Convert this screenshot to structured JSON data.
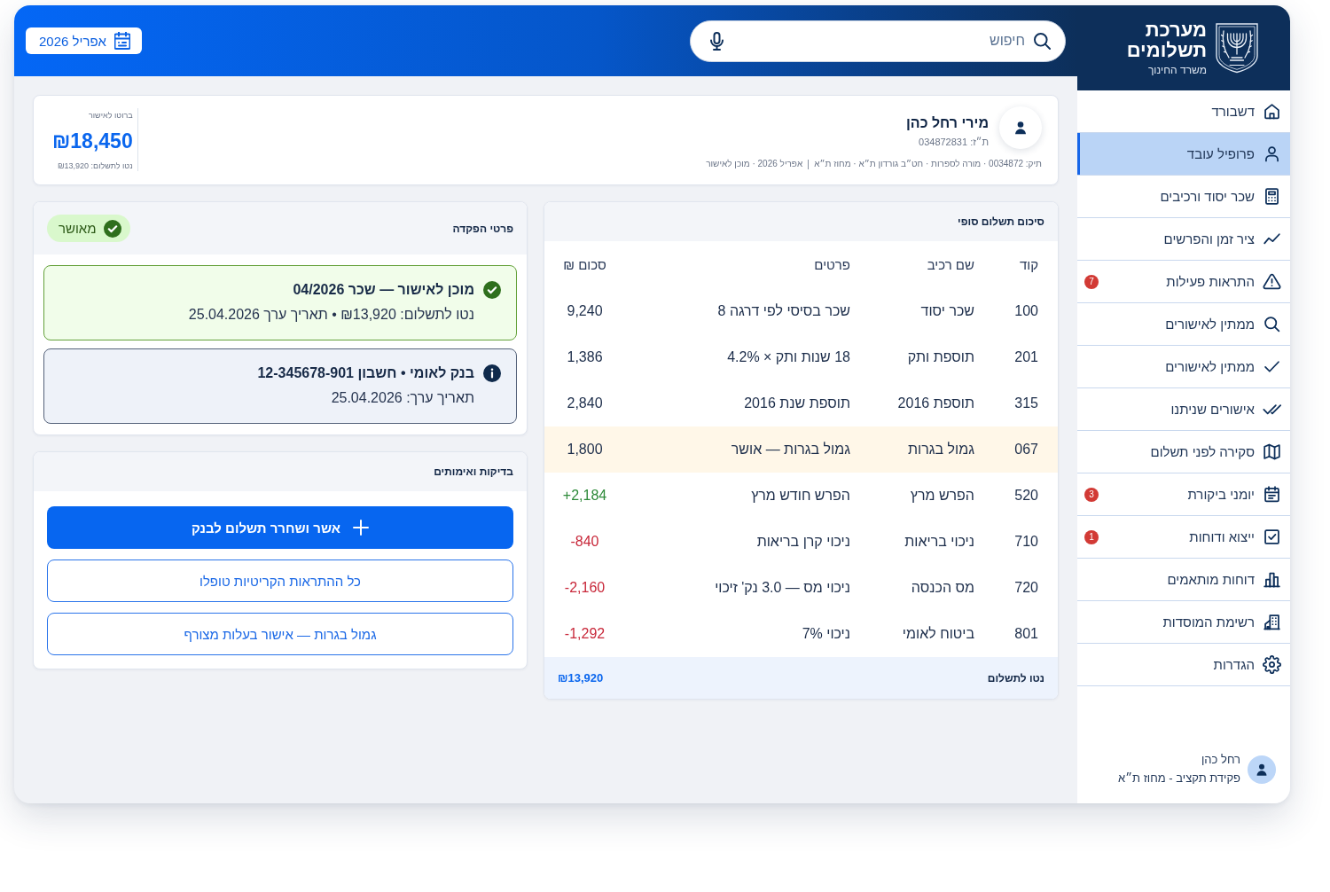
{
  "sidebar": {
    "logo": {
      "title": "מערכת תשלומים",
      "subtitle": "משרד החינוך"
    },
    "items": [
      {
        "label": "דשבורד",
        "selected": false
      },
      {
        "label": "פרופיל עובד",
        "selected": true
      },
      {
        "label": "שכר יסוד ורכיבים",
        "selected": false
      },
      {
        "label": "ציר זמן והפרשים",
        "selected": false
      },
      {
        "label": "התראות פעילות",
        "selected": false,
        "badge": "7"
      },
      {
        "label": "ממתין לאישורים",
        "selected": false
      },
      {
        "label": "ממתין לאישורים",
        "selected": false
      },
      {
        "label": "אישורים שניתנו",
        "selected": false
      },
      {
        "label": "סקירה לפני תשלום",
        "selected": false
      },
      {
        "label": "יומני ביקורת",
        "selected": false,
        "badge": "3"
      },
      {
        "label": "ייצוא ודוחות",
        "selected": false,
        "badge": "1"
      },
      {
        "label": "דוחות מותאמים",
        "selected": false
      },
      {
        "label": "רשימת המוסדות",
        "selected": false
      },
      {
        "label": "הגדרות",
        "selected": false
      }
    ],
    "user": {
      "name": "רחל כהן",
      "role": "פקידת תקציב - מחוז ת״א"
    }
  },
  "header": {
    "search": {
      "placeholder": "חיפוש"
    },
    "period_button": "אפריל 2026"
  },
  "profile": {
    "name": "מירי רחל כהן",
    "id_number": "ת״ז: 034872831",
    "details": "תיק: 0034872 · מורה לספרות · חט״ב גורדון ת״א · מחוז ת״א",
    "period_status": "אפריל 2026 · מוכן לאישור",
    "gross_label": "ברוטו לאישור",
    "gross_value": "₪18,450",
    "net_line": "נטו לתשלום: ₪13,920"
  },
  "payment_summary": {
    "title": "סיכום תשלום סופי",
    "columns": [
      "קוד",
      "שם רכיב",
      "פרטים",
      "סכום ₪"
    ],
    "rows": [
      {
        "code": "100",
        "component": "שכר יסוד",
        "details": "שכר בסיסי לפי דרגה 8",
        "amount": "9,240",
        "kind": "plain",
        "highlighted": false
      },
      {
        "code": "201",
        "component": "תוספת ותק",
        "details": "18 שנות ותק × 4.2%",
        "amount": "1,386",
        "kind": "plain",
        "highlighted": false
      },
      {
        "code": "315",
        "component": "תוספת 2016",
        "details": "תוספת שנת 2016",
        "amount": "2,840",
        "kind": "plain",
        "highlighted": false
      },
      {
        "code": "067",
        "component": "גמול בגרות",
        "details": "גמול בגרות — אושר",
        "amount": "1,800",
        "kind": "plain",
        "highlighted": true
      },
      {
        "code": "520",
        "component": "הפרש מרץ",
        "details": "הפרש חודש מרץ",
        "amount": "+2,184",
        "kind": "credit",
        "highlighted": false
      },
      {
        "code": "710",
        "component": "ניכוי בריאות",
        "details": "ניכוי קרן בריאות",
        "amount": "-840",
        "kind": "debit",
        "highlighted": false
      },
      {
        "code": "720",
        "component": "מס הכנסה",
        "details": "ניכוי מס — 3.0 נק' זיכוי",
        "amount": "-2,160",
        "kind": "debit",
        "highlighted": false
      },
      {
        "code": "801",
        "component": "ביטוח לאומי",
        "details": "ניכוי 7%",
        "amount": "-1,292",
        "kind": "debit",
        "highlighted": false
      }
    ],
    "total": {
      "label": "נטו לתשלום",
      "value": "₪13,920"
    }
  },
  "deposit": {
    "title": "פרטי הפקדה",
    "status": "מאושר",
    "notices": [
      {
        "kind": "success",
        "title": "מוכן לאישור — שכר 04/2026",
        "text": "נטו לתשלום: ₪13,920 • תאריך ערך 25.04.2026"
      },
      {
        "kind": "info",
        "title": "בנק לאומי • חשבון 12-345678-901",
        "text": "תאריך ערך: 25.04.2026"
      }
    ]
  },
  "checks": {
    "title": "בדיקות ואימותים",
    "actions": [
      {
        "kind": "primary",
        "label": "אשר ושחרר תשלום לבנק"
      },
      {
        "kind": "outline",
        "label": "כל ההתראות הקריטיות טופלו"
      },
      {
        "kind": "outline",
        "label": "גמול בגרות — אישור בעלות מצורף"
      }
    ]
  }
}
